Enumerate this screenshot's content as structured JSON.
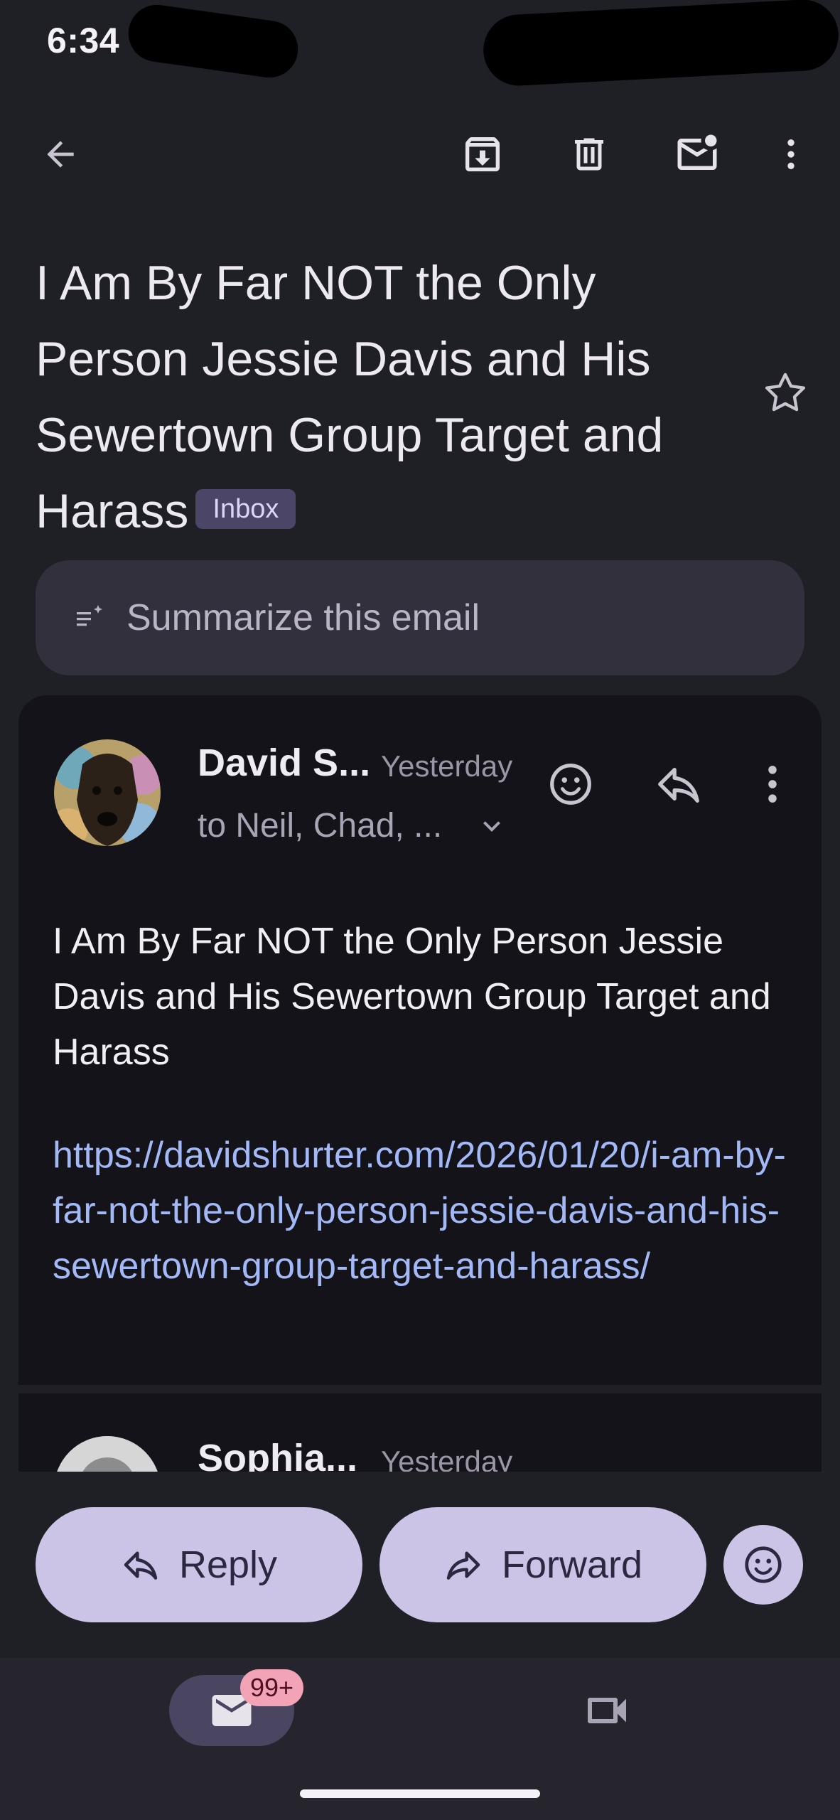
{
  "status_bar": {
    "time": "6:34"
  },
  "toolbar": {
    "icons": [
      "back-arrow-icon",
      "archive-icon",
      "trash-icon",
      "mark-unread-icon",
      "more-vert-icon"
    ]
  },
  "email": {
    "subject": "I Am By Far NOT the Only Person Jessie Davis and His Sewertown Group Target and Harass",
    "label": "Inbox"
  },
  "summarize": {
    "label": "Summarize this email"
  },
  "messages": [
    {
      "sender": "David S...",
      "date": "Yesterday",
      "recipients": "to Neil, Chad, ...",
      "body": "I Am By Far NOT the Only Person Jessie Davis and His Sewertown Group Target and Harass",
      "link": "https://davidshurter.com/2026/01/20/i-am-by-far-not-the-only-person-jessie-davis-and-his-sewertown-group-target-and-harass/"
    },
    {
      "sender": "Sophia...",
      "date": "Yesterday"
    }
  ],
  "actions": {
    "reply": "Reply",
    "forward": "Forward"
  },
  "bottom_nav": {
    "mail_badge": "99+"
  },
  "colors": {
    "background": "#1f1f26",
    "card": "#131319",
    "pill": "#cbc4e6",
    "link": "#a3b9f7",
    "badge": "#f2a3b5"
  }
}
